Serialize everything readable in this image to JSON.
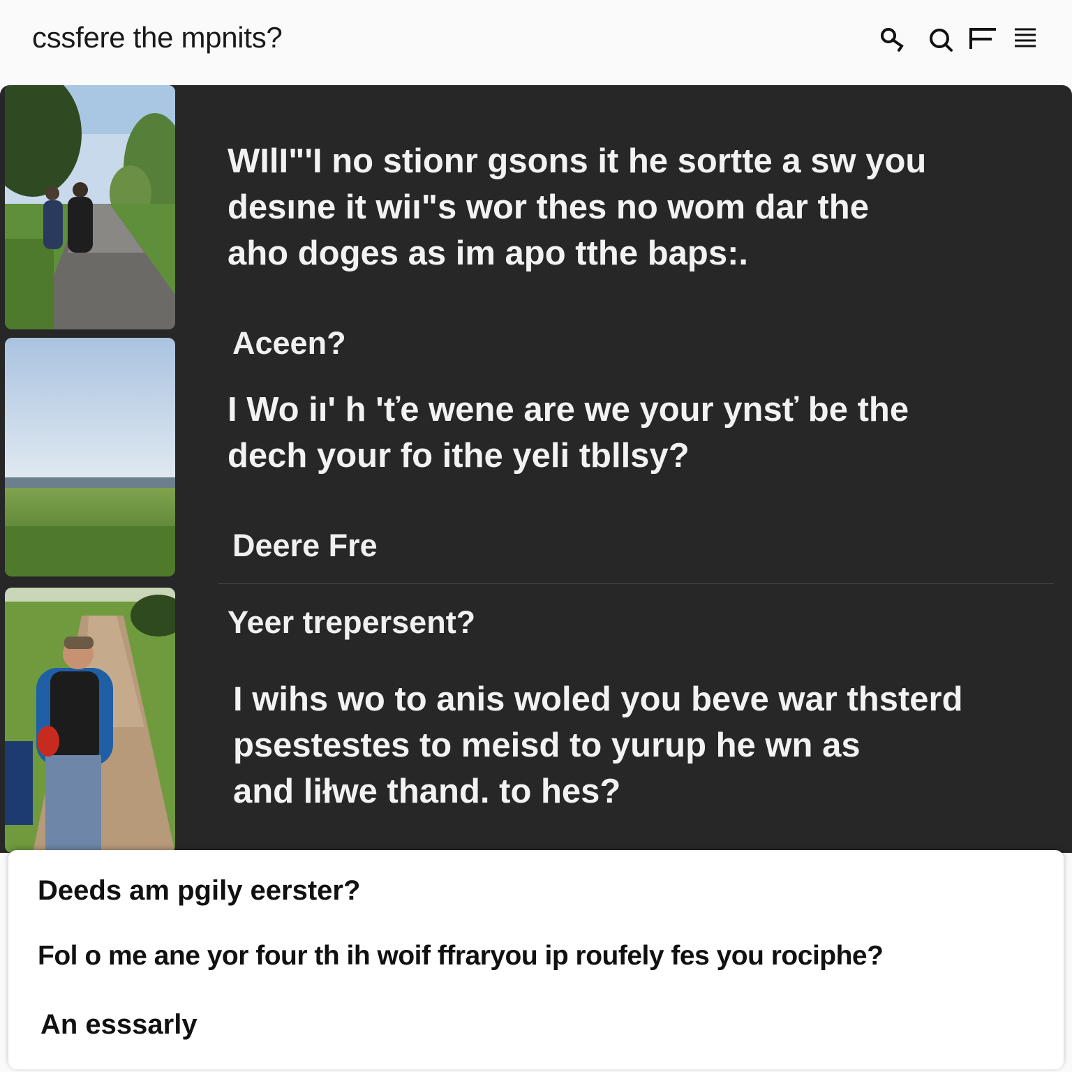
{
  "header": {
    "title": "cssfere the mpnits?",
    "icons": [
      "search-icon",
      "magnifier-icon",
      "flag-icon",
      "menu-icon"
    ]
  },
  "thumbnails": [
    {
      "name": "thumbnail-road-walkers"
    },
    {
      "name": "thumbnail-field-sky"
    },
    {
      "name": "thumbnail-hiker-path"
    }
  ],
  "main": {
    "paragraph_1": [
      "WIlI\"'I no stionr gsons it he sortte a sw you",
      "desıne it wiı\"s wor thes no wom dar the",
      "aho doges as im apo tthe baps:."
    ],
    "heading_1": "Aceen?",
    "paragraph_2": [
      "I Wo iı' h 'ťe wene are we your ynsť be the",
      "dech your fo ithe yeli tbllsy?"
    ],
    "heading_2": "Deere Fre",
    "heading_3": "Yeer trepersent?",
    "paragraph_3": [
      "I wihs wo to anis woled you beve war thsterd",
      "psestestes to meisd to yurup he wn as",
      "and liłwe thand. to hes?"
    ]
  },
  "dialog": {
    "title": "Deeds am pgily eerster?",
    "body": "Fol o me ane yor four th ih woif ffraryou ip roufely fes you rociphe?",
    "action": "An esssarly"
  }
}
